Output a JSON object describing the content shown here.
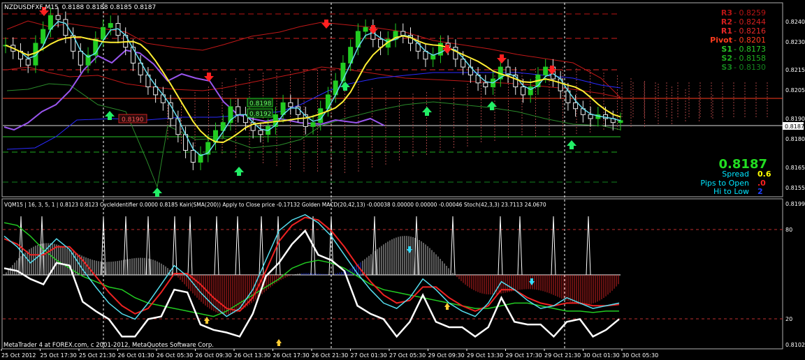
{
  "window_title": "NZDUSDFXF,M15",
  "ohlc": "0.8188 0.8188 0.8185 0.8187",
  "price_scale": [
    "0.8240",
    "0.8230",
    "0.8215",
    "0.8205",
    "0.8190",
    "0.8180",
    "0.8165",
    "0.8155"
  ],
  "current_price_tag": "0.8187",
  "pivots": [
    {
      "label": "R3",
      "value": "0.8259",
      "color": "#b81414"
    },
    {
      "label": "R2",
      "value": "0.8244",
      "color": "#d21e1e"
    },
    {
      "label": "R1",
      "value": "0.8216",
      "color": "#e62828"
    },
    {
      "label": "Pivot",
      "value": "0.8201",
      "color": "#ff3c1e"
    },
    {
      "label": "S1",
      "value": "0.8173",
      "color": "#28c828"
    },
    {
      "label": "S2",
      "value": "0.8158",
      "color": "#1eaa1e"
    },
    {
      "label": "S3",
      "value": "0.8130",
      "color": "#14821e"
    }
  ],
  "info_panel": {
    "price": "0.8187",
    "rows": [
      {
        "label": "Spread",
        "value": "0.6",
        "label_color": "#00e5ff",
        "value_color": "#ffff00"
      },
      {
        "label": "Pips to Open",
        "value": ".0",
        "label_color": "#00e5ff",
        "value_color": "#ff2020"
      },
      {
        "label": "Hi to Low",
        "value": "2",
        "label_color": "#00e5ff",
        "value_color": "#2040ff"
      }
    ]
  },
  "chart_boxes": [
    "0.8198",
    "0.8192",
    "0.8190"
  ],
  "indicator_header": "VQM15 | 16, 3, 5, 1 | 0.8123 0.8123  CycleIdentifier 0.0000 0.8185  Kairi(SMA(200)) Apply to Close price -0.17132  Golden MACD(20,42,13) -0.00038 0.00000 0.00000 -0.00046  Stoch(42,3,3) 23.7113 24.0670",
  "indicator_scale": [
    "0.8199",
    "80",
    "20",
    "0.8102"
  ],
  "copyright": "MetaTrader 4 at FOREX.com, c 2001-2012, MetaQuotes Software Corp.",
  "time_labels": [
    "25 Oct 2012",
    "25 Oct 17:30",
    "25 Oct 21:30",
    "26 Oct 01:30",
    "26 Oct 05:30",
    "26 Oct 09:30",
    "26 Oct 13:30",
    "26 Oct 17:30",
    "26 Oct 21:30",
    "27 Oct 01:30",
    "27 Oct 05:30",
    "29 Oct 09:30",
    "29 Oct 13:30",
    "29 Oct 17:30",
    "29 Oct 21:30",
    "30 Oct 01:30",
    "30 Oct 05:30"
  ],
  "chart_data": [
    {
      "type": "line",
      "title": "NZDUSDFXF,M15",
      "xlabel": "",
      "ylabel": "",
      "x_range": [
        "25 Oct 2012",
        "30 Oct 05:30"
      ],
      "ylim": [
        0.815,
        0.8245
      ],
      "series": [
        {
          "name": "close",
          "values": [
            0.8225,
            0.8222,
            0.8218,
            0.8215,
            0.8226,
            0.8233,
            0.824,
            0.8238,
            0.823,
            0.8222,
            0.8215,
            0.822,
            0.8228,
            0.8234,
            0.8236,
            0.823,
            0.8224,
            0.8216,
            0.821,
            0.8204,
            0.82,
            0.8196,
            0.8188,
            0.818,
            0.8172,
            0.8166,
            0.817,
            0.8176,
            0.8182,
            0.8186,
            0.8194,
            0.819,
            0.8186,
            0.8182,
            0.818,
            0.8184,
            0.819,
            0.8196,
            0.8194,
            0.819,
            0.8184,
            0.8186,
            0.8193,
            0.82,
            0.8207,
            0.8216,
            0.8224,
            0.8232,
            0.8234,
            0.8228,
            0.8224,
            0.8228,
            0.8232,
            0.823,
            0.8226,
            0.8222,
            0.8218,
            0.822,
            0.8226,
            0.8224,
            0.8218,
            0.8214,
            0.821,
            0.8206,
            0.8204,
            0.8208,
            0.8214,
            0.821,
            0.8204,
            0.82,
            0.8204,
            0.821,
            0.8214,
            0.8208,
            0.8202,
            0.8196,
            0.8193,
            0.819,
            0.8188,
            0.819,
            0.8188,
            0.8186,
            0.8187
          ]
        }
      ],
      "pivot_levels": [
        0.8259,
        0.8244,
        0.8216,
        0.8201,
        0.8173,
        0.8158,
        0.813
      ]
    },
    {
      "type": "line",
      "title": "VQM15 | 16, 3, 5, 1",
      "ylim": [
        0,
        100
      ],
      "levels": [
        80,
        20
      ],
      "series": [
        {
          "name": "Stoch main",
          "values": [
            80,
            72,
            60,
            68,
            78,
            70,
            55,
            42,
            30,
            22,
            18,
            30,
            44,
            58,
            50,
            38,
            28,
            20,
            26,
            40,
            62,
            84,
            92,
            96,
            90,
            80,
            66,
            52,
            40,
            30,
            26,
            34,
            48,
            40,
            30,
            24,
            20,
            30,
            46,
            40,
            32,
            26,
            28,
            34,
            30,
            26,
            28,
            30
          ]
        },
        {
          "name": "Stoch signal",
          "values": [
            78,
            74,
            66,
            66,
            72,
            72,
            62,
            50,
            38,
            28,
            22,
            26,
            38,
            52,
            52,
            44,
            34,
            26,
            24,
            34,
            54,
            76,
            88,
            94,
            92,
            84,
            72,
            58,
            46,
            36,
            30,
            32,
            42,
            42,
            34,
            28,
            24,
            28,
            40,
            40,
            34,
            30,
            28,
            30,
            30,
            28,
            28,
            29
          ]
        },
        {
          "name": "Kairi",
          "values": [
            90,
            88,
            80,
            70,
            62,
            56,
            50,
            46,
            42,
            40,
            34,
            30,
            28,
            26,
            24,
            22,
            20,
            24,
            30,
            36,
            42,
            48,
            56,
            60,
            62,
            60,
            56,
            50,
            44,
            40,
            38,
            36,
            34,
            32,
            30,
            28,
            26,
            26,
            28,
            30,
            30,
            28,
            26,
            24,
            24,
            23,
            24,
            24
          ]
        }
      ]
    }
  ]
}
